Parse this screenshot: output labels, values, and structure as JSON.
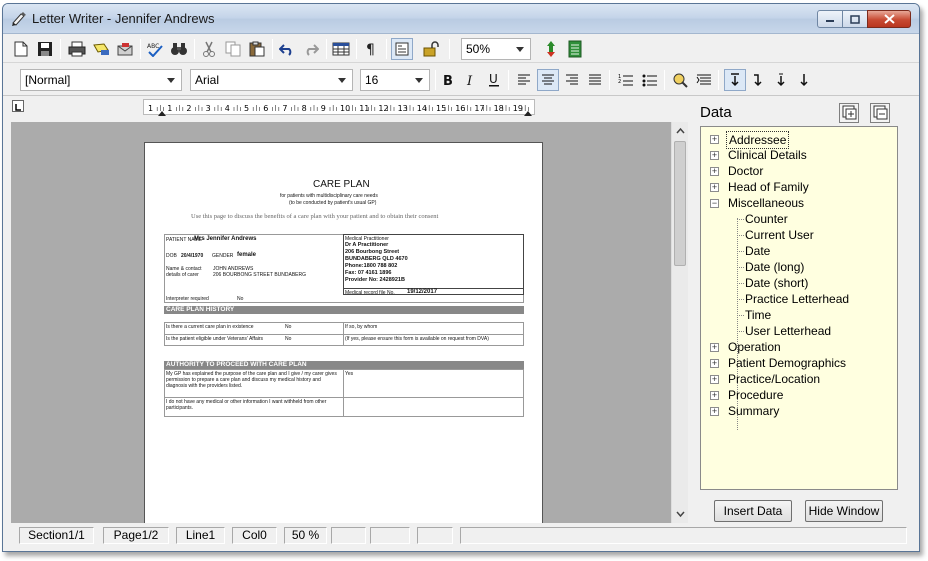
{
  "window": {
    "title": "Letter Writer - Jennifer Andrews"
  },
  "toolbar": {
    "zoom": "50%",
    "style": "[Normal]",
    "font": "Arial",
    "size": "16"
  },
  "ruler": {
    "ticks": [
      "1",
      "1",
      "2",
      "3",
      "4",
      "5",
      "6",
      "7",
      "8",
      "9",
      "10",
      "11",
      "12",
      "13",
      "14",
      "15",
      "16",
      "17",
      "18",
      "19"
    ]
  },
  "document": {
    "title": "CARE PLAN",
    "sub1": "for patients with multidisciplinary care needs",
    "sub2": "(to be conducted by patient's usual GP)",
    "intro": "Use this page to discuss the benefits of a care plan with your patient and to obtain their consent",
    "patient_name_label": "PATIENT NAME",
    "patient_name": "Mrs Jennifer Andrews",
    "dob_label": "DOB",
    "dob": "20/4/1970",
    "gender_label": "GENDER",
    "gender": "female",
    "carer_label": "Name & contact details of carer",
    "carer": "JOHN ANDREWS\n206 BOURBONG STREET BUNDABERG",
    "practitioner_label": "Medical Practitioner",
    "practitioner_lines": [
      "Dr A Practitioner",
      "206 Bourbong Street",
      "BUNDABERG QLD 4670",
      "Phone:1800 788 802",
      "Fax: 07 4161 1896",
      "Provider No: 2428921B"
    ],
    "recordfile_label": "Medical record file No.",
    "recordfile": "19/12/2017",
    "interpreter_label": "Interpreter required",
    "interpreter_value": "No",
    "section1": "CARE PLAN HISTORY",
    "row1_q": "Is there a current care plan in existence",
    "row1_a": "No",
    "row1_r": "If so, by whom",
    "row2_q": "Is the patient eligible under Veterans' Affairs",
    "row2_a": "No",
    "row2_r": "(If yes, please ensure this form is available on request from DVA)",
    "section2": "AUTHORITY TO PROCEED WITH CARE PLAN",
    "auth_text": "My GP has explained the purpose of the care plan and I give / my carer gives permission to prepare a care plan and discuss my medical history and diagnosis with the providers listed.",
    "auth_answer": "Yes",
    "withhold_text": "I do not have any medical or other information I want withheld from other participants."
  },
  "panel": {
    "title": "Data",
    "tree": [
      {
        "label": "Addressee",
        "expanded": false,
        "selected": true
      },
      {
        "label": "Clinical Details",
        "expanded": false
      },
      {
        "label": "Doctor",
        "expanded": false
      },
      {
        "label": "Head of Family",
        "expanded": false
      },
      {
        "label": "Miscellaneous",
        "expanded": true
      },
      {
        "label": "Operation",
        "expanded": false
      },
      {
        "label": "Patient Demographics",
        "expanded": false
      },
      {
        "label": "Practice/Location",
        "expanded": false
      },
      {
        "label": "Procedure",
        "expanded": false
      },
      {
        "label": "Summary",
        "expanded": false
      }
    ],
    "misc_children": [
      "Counter",
      "Current User",
      "Date",
      "Date (long)",
      "Date (short)",
      "Practice Letterhead",
      "Time",
      "User Letterhead"
    ],
    "insert_button": "Insert Data",
    "hide_button": "Hide Window"
  },
  "status": {
    "section": "Section1/1",
    "page": "Page1/2",
    "line": "Line1",
    "col": "Col0",
    "zoom": "50 %"
  }
}
